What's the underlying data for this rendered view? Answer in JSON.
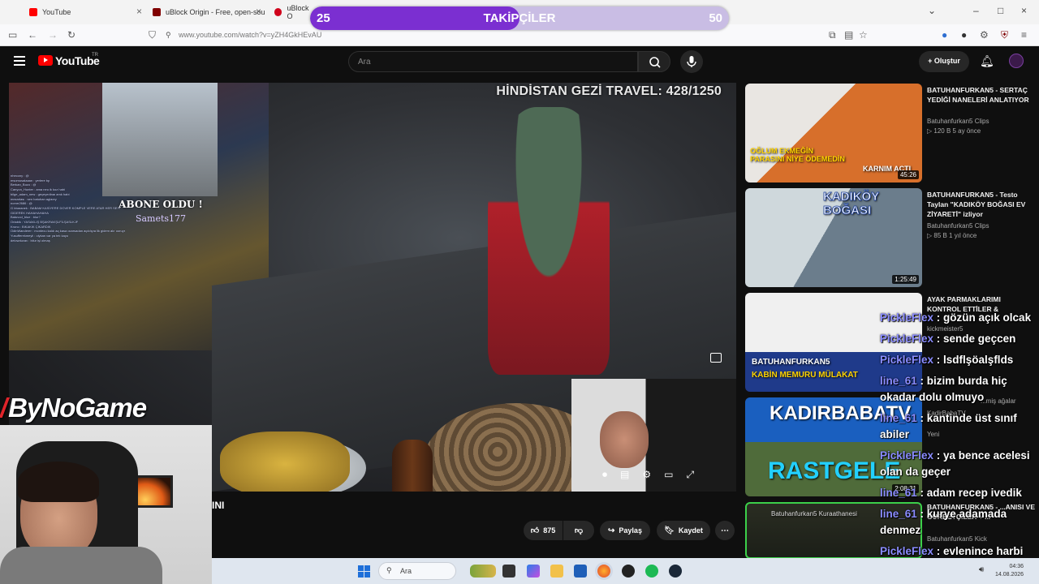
{
  "browser": {
    "tabs": [
      {
        "label": "YouTube",
        "color": "#ff0000"
      },
      {
        "label": "uBlock Origin - Free, open-sou",
        "color": "#800000"
      },
      {
        "label": "uBlock O",
        "color": "#d0021b"
      }
    ],
    "url": "www.youtube.com/watch?v=yZH4GkHEvAU"
  },
  "followers_bar": {
    "left_value": "25",
    "label": "TAKİPÇİLER",
    "right_value": "50",
    "progress_fraction": 0.5,
    "accent": "#7b2fd1"
  },
  "youtube": {
    "logo_text": "YouTube",
    "logo_suffix": "TR",
    "search_placeholder": "Ara",
    "create_label": "Oluştur"
  },
  "video": {
    "overlay_title": "HİNDİSTAN GEZİ TRAVEL: 428/1250",
    "subscribe_alert": "ABONE OLDU !",
    "subscriber_name": "Samets177",
    "title_fragment": "INI",
    "mini_chat": [
      "nhecony : @",
      "msomusalaaan : yerlere bp",
      "Berkan_Bozo : @",
      "Canyon_Hunter : ama neu ik koz habi",
      "bilge_adam_new : geçeyedinaı amk habi",
      "mezarlası : sen batuhan aglaıey",
      "nomrr2686 : @",
      "G bbaranek : BABAM KASİYERE DOVER KOMPLE VERE ATAR HER SEYI",
      "GIDEREK HAHAHAHAHA",
      "Batuvod_blue : blur?",
      "Ortabik : YASAKLIŞ BŞAKRAKŞLFİLŞASLKJF",
      "Krono : BIKAKIK ÇIKARDIK",
      "OdinWanderer : montecu kaldı aq kasa ocarsadan açıldıyıa llk gidem alır ooruyr",
      "Yusufferekmeyii : olykan var ya telı kayo",
      "delowduvav : bilur işi olmaş"
    ]
  },
  "overlays": {
    "brand": "ByNoGame"
  },
  "actions": {
    "likes": "875",
    "share": "Paylaş",
    "save": "Kaydet"
  },
  "recommendations": [
    {
      "title": "BATUHANFURKAN5 - SERTAÇ YEDİĞİ NANELERİ ANLATIYOR",
      "channel": "Batuhanfurkan5 Clips",
      "meta": "120 B  5 ay önce",
      "duration": "45:26",
      "thumb_text_1": "OĞLUM EKMEĞİN PARASINI NİYE ÖDEMEDİN",
      "thumb_text_2": "KARNIM ACTI"
    },
    {
      "title": "BATUHANFURKAN5 - Testo Taylan \"KADIKÖY BOĞASI EV ZİYARETİ\" izliyor",
      "channel": "Batuhanfurkan5 Clips",
      "meta": "85 B  1 yıl önce",
      "duration": "1:25:49",
      "thumb_text_1": "KADIKÖY BOĞASI"
    },
    {
      "title": "AYAK PARMAKLARIMI KONTROL ETTİLER &",
      "channel": "kickmeister5",
      "meta": "",
      "duration": "",
      "thumb_text_1": "BATUHANFURKAN5",
      "thumb_text_2": "KABİN MEMURU MÜLAKAT"
    },
    {
      "title": "",
      "channel": "KadirBabaTV",
      "meta": "Yeni",
      "duration": "2:08:31",
      "thumb_text_1": "KADIRBABATV",
      "thumb_text_2": "RASTGELE",
      "extra": "...miş ağalar"
    },
    {
      "title": "BATUHANFURKAN5 - ...ANISI VE GURBETÇİLER + ...",
      "channel": "Batuhanfurkan5 Kick",
      "meta": "",
      "duration": "",
      "thumb_text_1": "Batuhanfurkan5 Kuraathanesi"
    }
  ],
  "chat": [
    {
      "user": "PickleFlex",
      "text": " : gözün açık olcak"
    },
    {
      "user": "PickleFlex",
      "text": " : sende geçcen"
    },
    {
      "user": "PickleFlex",
      "text": " : lsdflşöalşflds"
    },
    {
      "user": "line_61",
      "text": " : bizim burda hiç okadar dolu olmuyo"
    },
    {
      "user": "line_61",
      "text": " : kantinde üst sınıf abiler"
    },
    {
      "user": "PickleFlex",
      "text": " : ya bence acelesi olan da geçer"
    },
    {
      "user": "line_61",
      "text": " : adam recep ivedik"
    },
    {
      "user": "line_61",
      "text": " : kurye adamada denmez"
    },
    {
      "user": "PickleFlex",
      "text": " : evlenince harbi birbirine benziyon"
    }
  ],
  "taskbar": {
    "search": "Ara",
    "time": "04:36",
    "date": "14.08.2026"
  }
}
